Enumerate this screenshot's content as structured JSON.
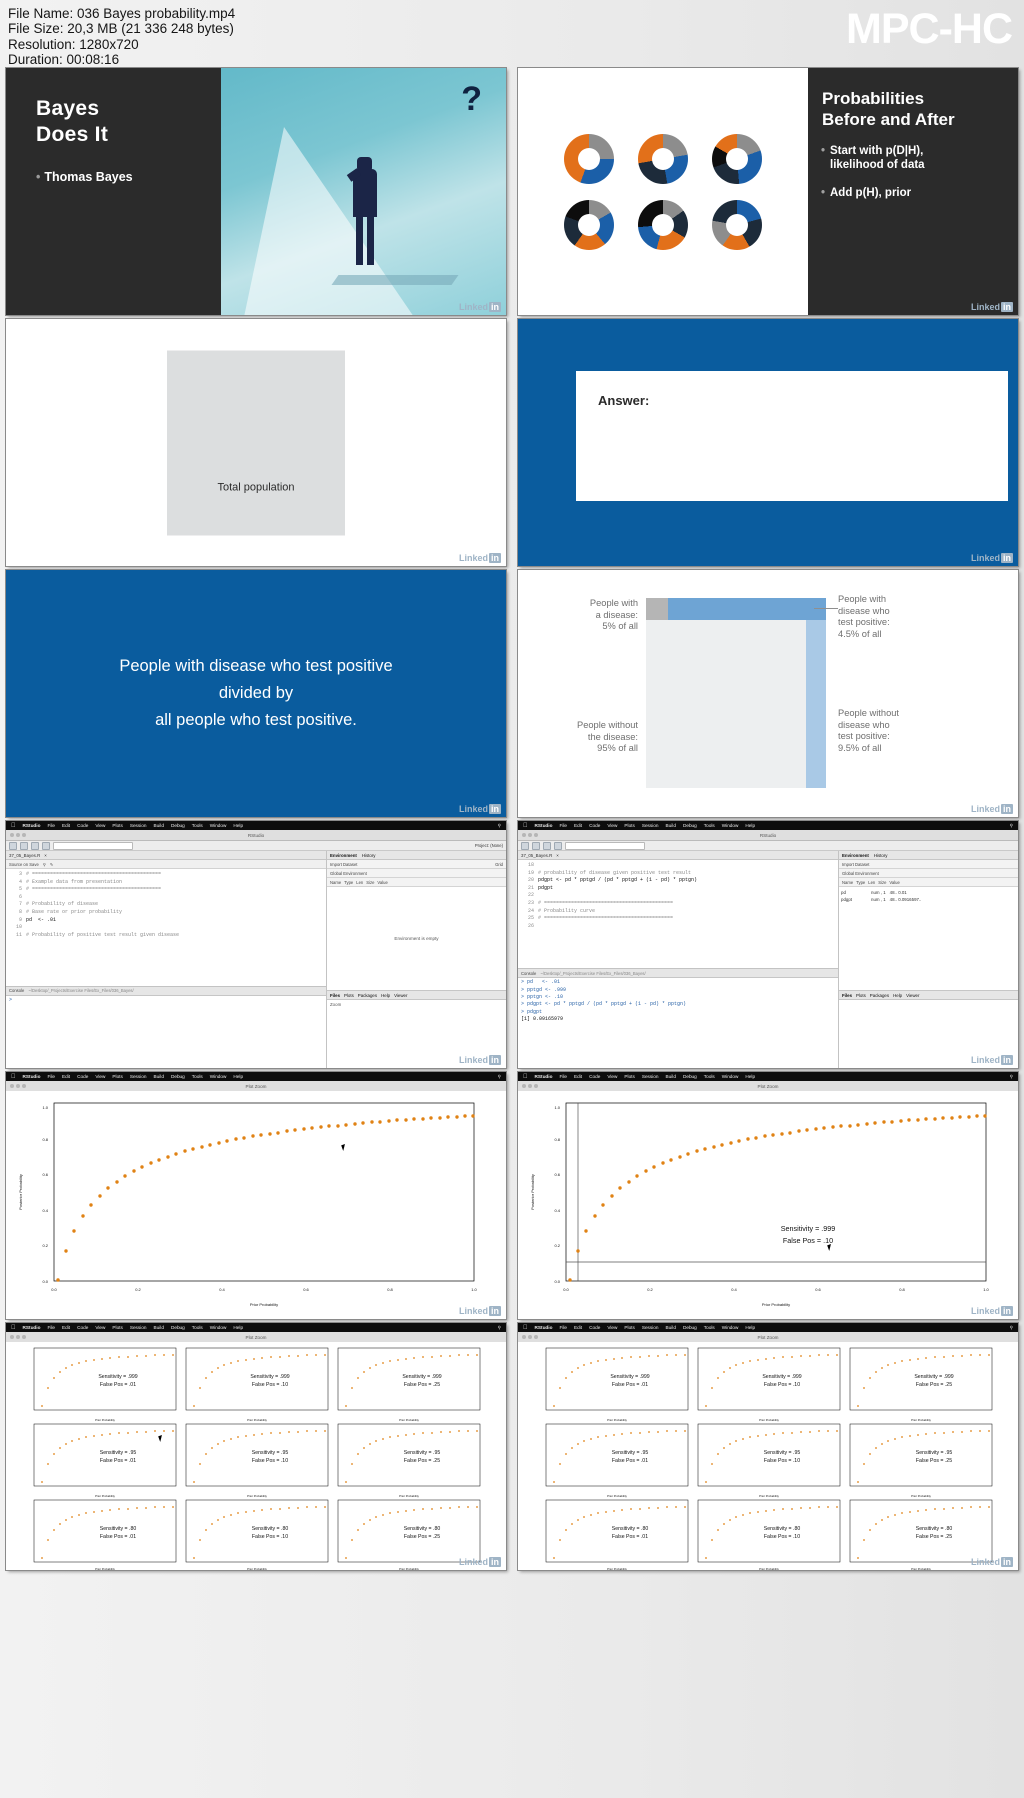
{
  "header": {
    "file_name_label": "File Name: 036 Bayes probability.mp4",
    "file_size_label": "File Size: 20,3 MB (21 336 248 bytes)",
    "resolution_label": "Resolution: 1280x720",
    "duration_label": "Duration: 00:08:16",
    "app_logo": "MPC-HC"
  },
  "brand": {
    "linkedin": "Linked",
    "linkedin_in": "in"
  },
  "colors": {
    "slide_blue": "#0a5c9e",
    "slide_dark": "#2b2b2b",
    "accent_orange": "#E2701A",
    "accent_gray": "#8D8D8D",
    "accent_navy": "#1D2B3A",
    "accent_blue": "#1B5FA8",
    "plot_line": "#E08214"
  },
  "slides": [
    {
      "id": "title-slide",
      "title_line1": "Bayes",
      "title_line2": "Does It",
      "bullet": "Thomas Bayes",
      "question_mark": "?"
    },
    {
      "id": "probabilities-slide",
      "title_line1": "Probabilities",
      "title_line2": "Before and After",
      "bullets": [
        "Start with p(D|H),\nlikelihood of data",
        "Add p(H), prior"
      ]
    },
    {
      "id": "total-population-slide",
      "box_label": "Total population"
    },
    {
      "id": "answer-slide",
      "answer_label": "Answer:"
    },
    {
      "id": "definition-slide",
      "line1": "People with disease who test positive",
      "line2": "divided by",
      "line3": "all people who test positive."
    },
    {
      "id": "diagram-slide",
      "label_top_left": "People with\na disease:\n5% of all",
      "label_bottom_left": "People without\nthe disease:\n95% of all",
      "label_top_right": "People with\ndisease who\ntest positive:\n4.5% of all",
      "label_bottom_right": "People without\ndisease who\ntest positive:\n9.5% of all"
    },
    {
      "id": "rstudio-1",
      "menu": [
        "RStudio",
        "File",
        "Edit",
        "Code",
        "View",
        "Plots",
        "Session",
        "Build",
        "Debug",
        "Tools",
        "Window",
        "Help"
      ],
      "window_title": "RStudio",
      "source_tab": "37_05_Bayes.R",
      "source_on_save": "Source on Save",
      "project_label": "Project: (None)",
      "code_lines": [
        {
          "n": "3",
          "t": "# ==========================================="
        },
        {
          "n": "4",
          "t": "# Example data from presentation"
        },
        {
          "n": "5",
          "t": "# ==========================================="
        },
        {
          "n": "6",
          "t": ""
        },
        {
          "n": "7",
          "t": "# Probability of disease"
        },
        {
          "n": "8",
          "t": "# Base rate or prior probability"
        },
        {
          "n": "9",
          "t": "pd  <- .01"
        },
        {
          "n": "10",
          "t": ""
        },
        {
          "n": "11",
          "t": "# Probability of positive test result given disease"
        }
      ],
      "console_label": "Console",
      "console_path": "~/Desktop/_Projects/Exercise Files/Ex_Files/036_Bayes/",
      "console_lines": [
        ">"
      ],
      "env_tabs": [
        "Environment",
        "History"
      ],
      "env_import": "Import Dataset",
      "env_global": "Global Environment",
      "env_cols": [
        "Name",
        "Type",
        "Len",
        "Size",
        "Value"
      ],
      "env_empty": "Environment is empty",
      "files_tabs": [
        "Files",
        "Plots",
        "Packages",
        "Help",
        "Viewer"
      ],
      "files_zoom": "Zoom",
      "grid_label": "Grid"
    },
    {
      "id": "rstudio-2",
      "menu": [
        "RStudio",
        "File",
        "Edit",
        "Code",
        "View",
        "Plots",
        "Session",
        "Build",
        "Debug",
        "Tools",
        "Window",
        "Help"
      ],
      "window_title": "RStudio",
      "source_tab": "37_05_Bayes.R",
      "code_lines": [
        {
          "n": "18",
          "t": ""
        },
        {
          "n": "19",
          "t": "# probability of disease given positive test result"
        },
        {
          "n": "20",
          "t": "pdgpt <- pd * pptgd / (pd * pptgd + (1 - pd) * pptgn)"
        },
        {
          "n": "21",
          "t": "pdgpt"
        },
        {
          "n": "22",
          "t": ""
        },
        {
          "n": "23",
          "t": "# ==========================================="
        },
        {
          "n": "24",
          "t": "# Probability curve"
        },
        {
          "n": "25",
          "t": "# ==========================================="
        },
        {
          "n": "26",
          "t": ""
        }
      ],
      "console_lines": [
        "> pd   <- .01",
        "> pptgd <- .999",
        "> pptgn <- .10",
        "> pdgpt <- pd * pptgd / (pd * pptgd + (1 - pd) * pptgn)",
        "> pdgpt",
        "[1] 0.09165979"
      ],
      "env_cols": [
        "Name",
        "Type",
        "Len",
        "Size",
        "Value"
      ],
      "env_rows": [
        [
          "pd",
          "num , 1",
          "48.. 0.01"
        ],
        [
          "pdgpt",
          "num , 1",
          "48.. 0.0916597.."
        ]
      ],
      "files_tabs": [
        "Files",
        "Plots",
        "Packages",
        "Help",
        "Viewer"
      ]
    },
    {
      "id": "plot-zoom-1",
      "menu": [
        "RStudio",
        "File",
        "Edit",
        "Code",
        "View",
        "Plots",
        "Session",
        "Build",
        "Debug",
        "Tools",
        "Window",
        "Help"
      ],
      "window_title": "Plot Zoom",
      "chart": {
        "xlabel": "Prior Probability",
        "ylabel": "Posterior Probability",
        "xticks": [
          "0.0",
          "0.2",
          "0.4",
          "0.6",
          "0.8",
          "1.0"
        ],
        "yticks": [
          "0.0",
          "0.2",
          "0.4",
          "0.6",
          "0.8",
          "1.0"
        ]
      }
    },
    {
      "id": "plot-zoom-2",
      "window_title": "Plot Zoom",
      "annotation_line1": "Sensitivity = .999",
      "annotation_line2": "False Pos = .10",
      "chart": {
        "xlabel": "Prior Probability",
        "ylabel": "Posterior Probability",
        "xticks": [
          "0.0",
          "0.2",
          "0.4",
          "0.6",
          "0.8",
          "1.0"
        ],
        "yticks": [
          "0.0",
          "0.2",
          "0.4",
          "0.6",
          "0.8",
          "1.0"
        ]
      }
    },
    {
      "id": "plot-grid-1",
      "window_title": "Plot Zoom",
      "panels": [
        {
          "sens": "Sensitivity = .999",
          "fp": "False Pos = .01"
        },
        {
          "sens": "Sensitivity = .999",
          "fp": "False Pos = .10"
        },
        {
          "sens": "Sensitivity = .999",
          "fp": "False Pos = .25"
        },
        {
          "sens": "Sensitivity = .95",
          "fp": "False Pos = .01"
        },
        {
          "sens": "Sensitivity = .95",
          "fp": "False Pos = .10"
        },
        {
          "sens": "Sensitivity = .95",
          "fp": "False Pos = .25"
        },
        {
          "sens": "Sensitivity = .80",
          "fp": "False Pos = .01"
        },
        {
          "sens": "Sensitivity = .80",
          "fp": "False Pos = .10"
        },
        {
          "sens": "Sensitivity = .80",
          "fp": "False Pos = .25"
        }
      ],
      "axis_label": "Prior Probability"
    },
    {
      "id": "plot-grid-2",
      "window_title": "Plot Zoom",
      "panels": [
        {
          "sens": "Sensitivity = .999",
          "fp": "False Pos = .01"
        },
        {
          "sens": "Sensitivity = .999",
          "fp": "False Pos = .10"
        },
        {
          "sens": "Sensitivity = .999",
          "fp": "False Pos = .25"
        },
        {
          "sens": "Sensitivity = .95",
          "fp": "False Pos = .01"
        },
        {
          "sens": "Sensitivity = .95",
          "fp": "False Pos = .10"
        },
        {
          "sens": "Sensitivity = .95",
          "fp": "False Pos = .25"
        },
        {
          "sens": "Sensitivity = .80",
          "fp": "False Pos = .01"
        },
        {
          "sens": "Sensitivity = .80",
          "fp": "False Pos = .10"
        },
        {
          "sens": "Sensitivity = .80",
          "fp": "False Pos = .25"
        }
      ],
      "axis_label": "Prior Probability"
    }
  ]
}
